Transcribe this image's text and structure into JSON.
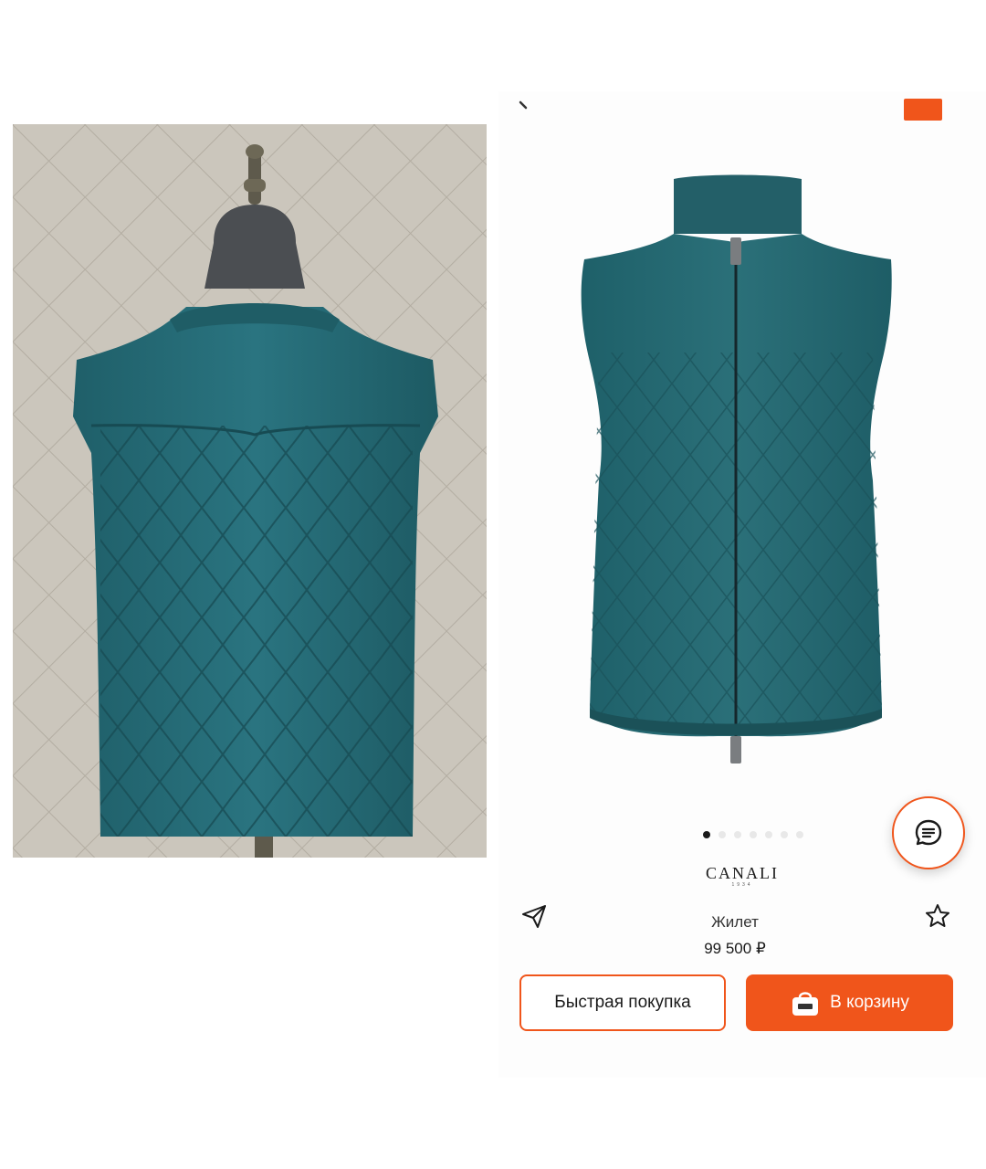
{
  "product": {
    "brand": "CANALI",
    "brand_sub": "1934",
    "name": "Жилет",
    "price": "99 500 ₽"
  },
  "gallery": {
    "total_images": 7,
    "active_index": 0
  },
  "actions": {
    "quick_buy_label": "Быстрая покупка",
    "add_to_cart_label": "В корзину"
  },
  "icons": {
    "back": "chevron-left-icon",
    "chat": "chat-bubble-icon",
    "share": "paper-plane-icon",
    "favorite": "star-outline-icon",
    "cart": "shopping-bag-icon"
  },
  "colors": {
    "accent": "#f0551b",
    "vest": "#2b6d76",
    "background": "#ffffff"
  }
}
